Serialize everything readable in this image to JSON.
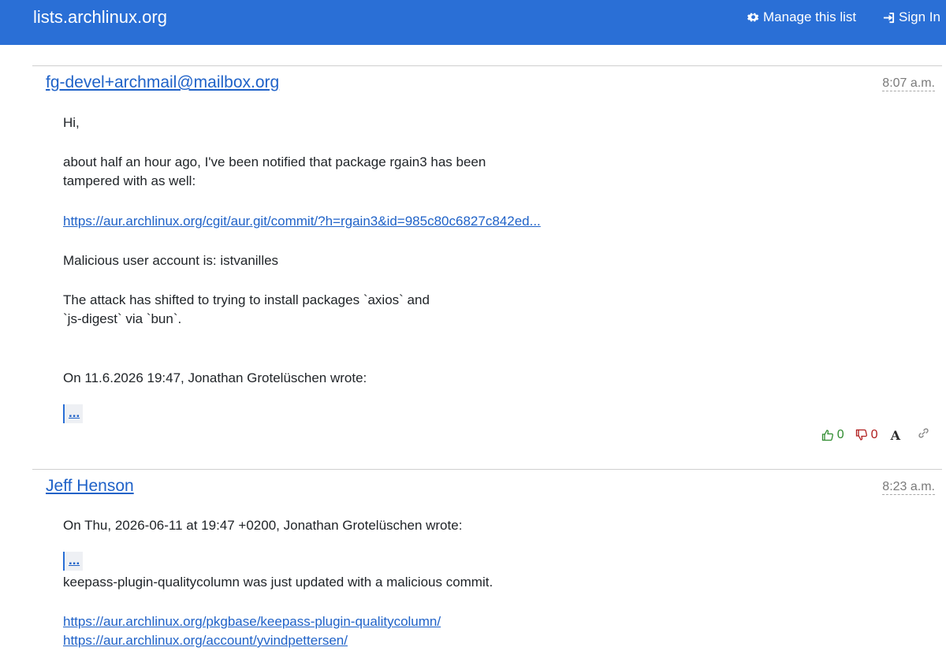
{
  "header": {
    "brand": "lists.archlinux.org",
    "manage_label": "Manage this list",
    "signin_label": "Sign In"
  },
  "colors": {
    "navbar": "#2a6fd6",
    "link": "#1f62c8",
    "vote_up": "#2e8b2e",
    "vote_down": "#b01c1c"
  },
  "emails": [
    {
      "sender": "fg-devel+archmail@mailbox.org",
      "time": "8:07 a.m.",
      "greeting": "Hi,",
      "para1_line1": "about half an hour ago, I've been notified that package rgain3 has been",
      "para1_line2": "tampered with as well:",
      "link1": "https://aur.archlinux.org/cgit/aur.git/commit/?h=rgain3&id=985c80c6827c842ed...",
      "para2": "Malicious user account is: istvanilles",
      "para3_line1": "The attack has shifted to trying to install packages `axios` and",
      "para3_line2": "`js-digest` via `bun`.",
      "attribution": "On 11.6.2026 19:47, Jonathan Grotelüschen wrote:",
      "quote_toggle": "...",
      "votes_up": "0",
      "votes_down": "0",
      "fixed_font_label": "A"
    },
    {
      "sender": "Jeff Henson",
      "time": "8:23 a.m.",
      "attribution": "On Thu, 2026-06-11 at 19:47 +0200, Jonathan Grotelüschen wrote:",
      "quote_toggle": "...",
      "para1": "keepass-plugin-qualitycolumn was just updated with a malicious commit.",
      "link1": "https://aur.archlinux.org/pkgbase/keepass-plugin-qualitycolumn/",
      "link2": "https://aur.archlinux.org/account/yvindpettersen/"
    }
  ]
}
